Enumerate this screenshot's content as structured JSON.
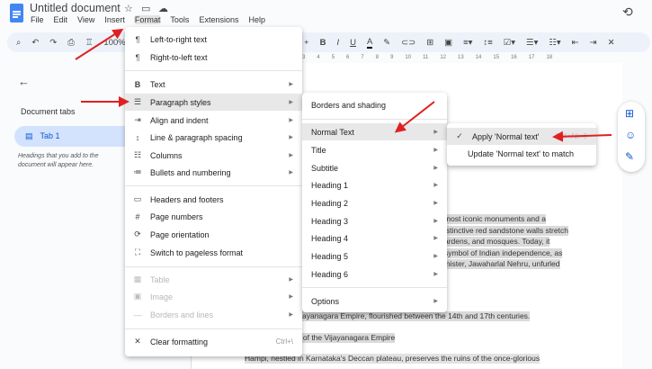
{
  "app": {
    "title": "Untitled document",
    "menu": [
      "File",
      "Edit",
      "View",
      "Insert",
      "Format",
      "Tools",
      "Extensions",
      "Help"
    ],
    "zoom": "100%"
  },
  "ruler": [
    "3",
    "4",
    "5",
    "6",
    "7",
    "8",
    "9",
    "10",
    "11",
    "12",
    "13",
    "14",
    "15",
    "16",
    "17",
    "18"
  ],
  "sidebar": {
    "heading": "Document tabs",
    "tab": "Tab 1",
    "hint": "Headings that you add to the document will appear here."
  },
  "format_menu": {
    "items": [
      {
        "label": "Left-to-right text",
        "icon": "ltr-icon"
      },
      {
        "label": "Right-to-left text",
        "icon": "rtl-icon"
      },
      {
        "label": "Text",
        "icon": "bold-icon"
      },
      {
        "label": "Paragraph styles",
        "icon": "paragraph-icon"
      },
      {
        "label": "Align and indent",
        "icon": "indent-icon"
      },
      {
        "label": "Line & paragraph spacing",
        "icon": "spacing-icon"
      },
      {
        "label": "Columns",
        "icon": "columns-icon"
      },
      {
        "label": "Bullets and numbering",
        "icon": "list-icon"
      },
      {
        "label": "Headers and footers",
        "icon": "header-icon"
      },
      {
        "label": "Page numbers",
        "icon": "hash-icon"
      },
      {
        "label": "Page orientation",
        "icon": "rotate-icon"
      },
      {
        "label": "Switch to pageless format",
        "icon": "pageless-icon"
      },
      {
        "label": "Table",
        "icon": "table-icon"
      },
      {
        "label": "Image",
        "icon": "image-icon"
      },
      {
        "label": "Borders and lines",
        "icon": "line-icon"
      },
      {
        "label": "Clear formatting",
        "icon": "clear-format-icon",
        "shortcut": "Ctrl+\\"
      }
    ]
  },
  "paragraph_menu": {
    "items": [
      "Borders and shading",
      "Normal Text",
      "Title",
      "Subtitle",
      "Heading 1",
      "Heading 2",
      "Heading 3",
      "Heading 4",
      "Heading 5",
      "Heading 6",
      "Options"
    ]
  },
  "normal_text_menu": {
    "apply": "Apply 'Normal text'",
    "apply_shortcut": "Ctrl+Alt+0",
    "update": "Update 'Normal text' to match"
  },
  "document": {
    "lines": [
      "most iconic monuments and a",
      "istinctive red sandstone walls stretch",
      "ardens, and mosques. Today, it",
      "symbol of Indian independence, as",
      "inister, Jawaharlal Nehru, unfurled",
      "ayanagara Empire, flourished between the 14th and 17th centuries.",
      "Marvel of the Vijayanagara Empire",
      "Hampi, nestled in Karnataka's Deccan plateau, preserves the ruins of the once-glorious"
    ]
  },
  "colors": {
    "accent": "#0b57d0",
    "arrow": "#e02020"
  }
}
